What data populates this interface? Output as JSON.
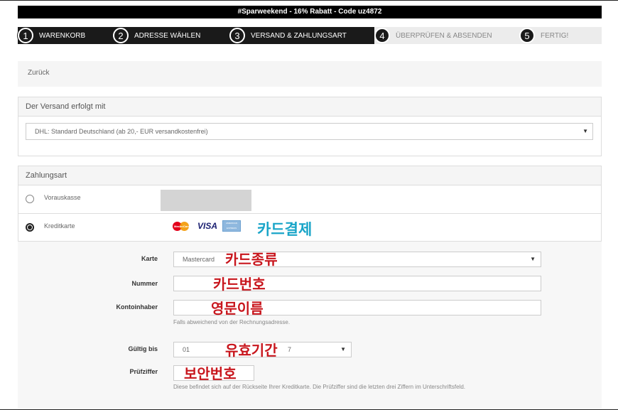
{
  "promo": {
    "text": "#Sparweekend - 16% Rabatt - Code uz4872"
  },
  "steps": [
    {
      "num": "1",
      "label": "WARENKORB"
    },
    {
      "num": "2",
      "label": "ADRESSE WÄHLEN"
    },
    {
      "num": "3",
      "label": "VERSAND & ZAHLUNGSART"
    },
    {
      "num": "4",
      "label": "ÜBERPRÜFEN & ABSENDEN"
    },
    {
      "num": "5",
      "label": "FERTIG!"
    }
  ],
  "back": {
    "label": "Zurück"
  },
  "shipping": {
    "title": "Der Versand erfolgt mit",
    "selected": "DHL: Standard Deutschland (ab 20,- EUR versandkostenfrei)",
    "arrow": "▼"
  },
  "payment": {
    "title": "Zahlungsart",
    "options": [
      {
        "label": "Vorauskasse",
        "selected": false
      },
      {
        "label": "Kreditkarte",
        "selected": true
      }
    ],
    "card_logos": {
      "mastercard": "MasterCard",
      "visa": "VISA",
      "amex": "AMERICAN EXPRESS"
    }
  },
  "annotations": {
    "card_payment": "카드결제",
    "card_type": "카드종류",
    "card_number": "카드번호",
    "english_name": "영문이름",
    "expiry": "유효기간",
    "security_code": "보안번호"
  },
  "form": {
    "card": {
      "label": "Karte",
      "value": "Mastercard",
      "arrow": "▼"
    },
    "number": {
      "label": "Nummer",
      "value": ""
    },
    "holder": {
      "label": "Kontoinhaber",
      "value": "",
      "help": "Falls abweichend von der Rechnungsadresse."
    },
    "valid": {
      "label": "Gültig bis",
      "month": "01",
      "year_fragment": "7",
      "arrow": "▼"
    },
    "cvc": {
      "label": "Prüfziffer",
      "value": "",
      "help": "Diese befindet sich auf der Rückseite Ihrer Kreditkarte. Die Prüfziffer sind die letzten drei Ziffern im Unterschriftsfeld."
    }
  },
  "colors": {
    "accent_dark": "#1a1a1a",
    "annotation_red": "#c8161d",
    "annotation_cyan": "#1aa5c8"
  }
}
